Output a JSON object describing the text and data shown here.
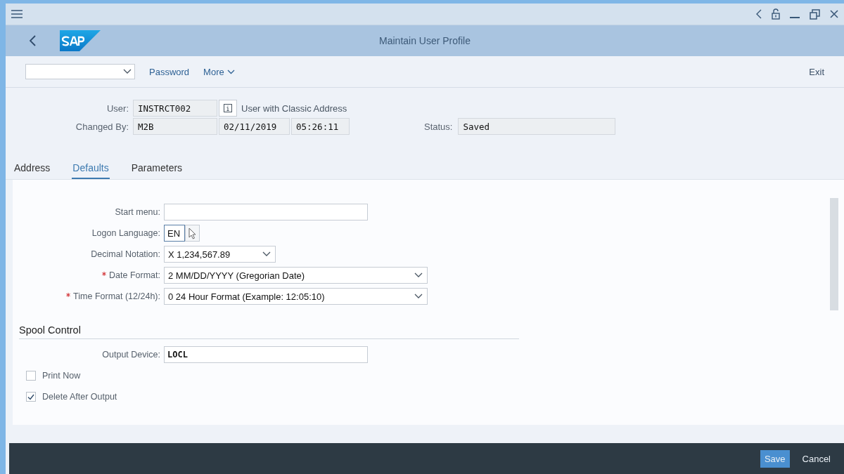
{
  "window": {
    "title": "Maintain User Profile"
  },
  "toolbar": {
    "actions": [
      "Password",
      "More"
    ],
    "exit": "Exit"
  },
  "header": {
    "user_label": "User:",
    "user": "INSTRCT002",
    "user_note": "User with Classic Address",
    "changed_by_label": "Changed By:",
    "changed_by": "M2B",
    "date": "02/11/2019",
    "time": "05:26:11",
    "status_label": "Status:",
    "status": "Saved"
  },
  "tabs": [
    {
      "label": "Address",
      "selected": false
    },
    {
      "label": "Defaults",
      "selected": true
    },
    {
      "label": "Parameters",
      "selected": false
    }
  ],
  "defaults": [
    {
      "kind": "text",
      "label": "Start menu:",
      "required": false
    },
    {
      "kind": "language",
      "label": "Logon Language:",
      "value": "EN",
      "required": false
    },
    {
      "kind": "select",
      "label": "Decimal Notation:",
      "value": "X 1,234,567.89",
      "required": false
    },
    {
      "kind": "wide_select",
      "label": "Date Format:",
      "value": "2 MM/DD/YYYY (Gregorian Date)",
      "required": true
    },
    {
      "kind": "wide_select",
      "label": "Time Format (12/24h):",
      "value": "0 24 Hour Format (Example: 12:05:10)",
      "required": true
    }
  ],
  "spool": {
    "title": "Spool Control",
    "output_label": "Output Device:",
    "output_value": "LOCL",
    "options": [
      {
        "label": "Print Now",
        "checked": false
      },
      {
        "label": "Delete After Output",
        "checked": true
      }
    ]
  },
  "footer": {
    "buttons": [
      {
        "label": "Save",
        "kind": "primary"
      },
      {
        "label": "Cancel",
        "kind": "plain"
      }
    ]
  }
}
